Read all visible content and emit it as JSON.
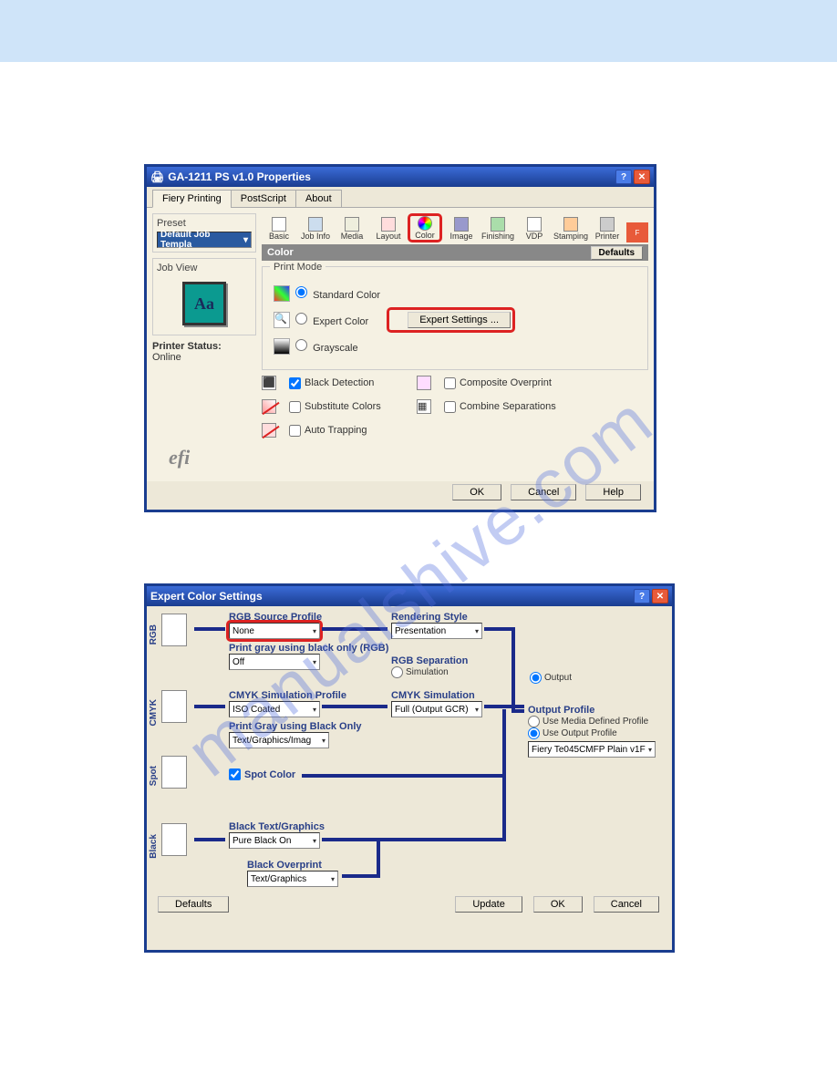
{
  "banner": {},
  "dialog1": {
    "title": "GA-1211 PS v1.0 Properties",
    "tabs": [
      "Fiery Printing",
      "PostScript",
      "About"
    ],
    "preset": {
      "label": "Preset",
      "value": "Default Job Templa"
    },
    "jobview": {
      "label": "Job View",
      "preview_text": "Aa"
    },
    "printer_status": {
      "label": "Printer Status:",
      "value": "Online"
    },
    "toolbar": [
      {
        "label": "Basic",
        "icon": "basic-icon"
      },
      {
        "label": "Job Info",
        "icon": "jobinfo-icon"
      },
      {
        "label": "Media",
        "icon": "media-icon"
      },
      {
        "label": "Layout",
        "icon": "layout-icon"
      },
      {
        "label": "Color",
        "icon": "color-icon",
        "highlight": true
      },
      {
        "label": "Image",
        "icon": "image-icon"
      },
      {
        "label": "Finishing",
        "icon": "finishing-icon"
      },
      {
        "label": "VDP",
        "icon": "vdp-icon"
      },
      {
        "label": "Stamping",
        "icon": "stamping-icon"
      },
      {
        "label": "Printer",
        "icon": "printer-icon"
      }
    ],
    "section": {
      "title": "Color",
      "defaults_btn": "Defaults"
    },
    "print_mode": {
      "title": "Print Mode",
      "options": [
        {
          "label": "Standard Color",
          "selected": true
        },
        {
          "label": "Expert Color",
          "selected": false
        },
        {
          "label": "Grayscale",
          "selected": false
        }
      ],
      "expert_btn": "Expert Settings ..."
    },
    "color_opts": {
      "black_detection": "Black Detection",
      "substitute_colors": "Substitute Colors",
      "auto_trapping": "Auto Trapping",
      "composite_overprint": "Composite Overprint",
      "combine_separations": "Combine Separations"
    },
    "logo": "efi",
    "buttons": {
      "ok": "OK",
      "cancel": "Cancel",
      "help": "Help"
    }
  },
  "dialog2": {
    "title": "Expert Color Settings",
    "sections": {
      "rgb": {
        "vlabel": "RGB",
        "rgb_source": {
          "label": "RGB Source Profile",
          "value": "None"
        },
        "print_gray": {
          "label": "Print gray using black only (RGB)",
          "value": "Off"
        },
        "rendering_style": {
          "label": "Rendering Style",
          "value": "Presentation"
        },
        "rgb_separation": {
          "label": "RGB Separation",
          "opt1": "Simulation",
          "opt2": "Output"
        }
      },
      "cmyk": {
        "vlabel": "CMYK",
        "sim_profile": {
          "label": "CMYK Simulation Profile",
          "value": "ISO Coated"
        },
        "print_gray": {
          "label": "Print Gray using Black Only",
          "value": "Text/Graphics/Imag"
        },
        "cmyk_sim": {
          "label": "CMYK Simulation",
          "value": "Full (Output GCR)"
        },
        "output_profile": {
          "label": "Output Profile",
          "opt1": "Use Media Defined Profile",
          "opt2": "Use Output Profile",
          "value": "Fiery Te045CMFP Plain v1F"
        }
      },
      "spot": {
        "vlabel": "Spot",
        "label": "Spot Color"
      },
      "black": {
        "vlabel": "Black",
        "text_graphics": {
          "label": "Black Text/Graphics",
          "value": "Pure Black On"
        },
        "overprint": {
          "label": "Black Overprint",
          "value": "Text/Graphics"
        }
      }
    },
    "buttons": {
      "defaults": "Defaults",
      "update": "Update",
      "ok": "OK",
      "cancel": "Cancel"
    }
  },
  "watermark": "manualshive.com"
}
